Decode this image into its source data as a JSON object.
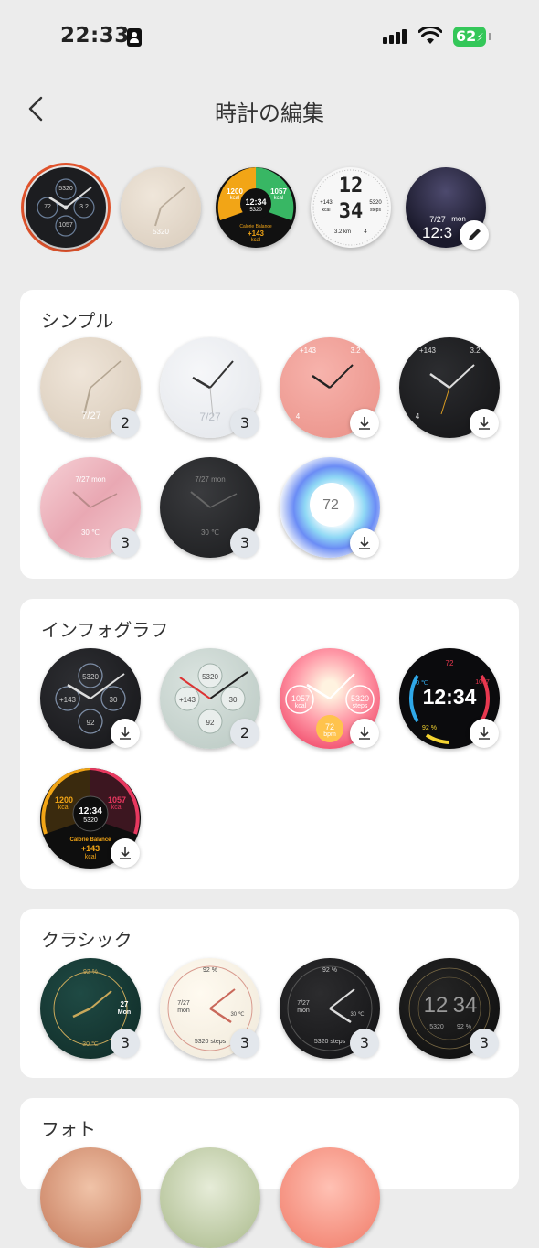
{
  "status_bar": {
    "time": "22:33",
    "battery": "62"
  },
  "nav": {
    "title": "時計の編集"
  },
  "current_faces": [
    {
      "name": "infograph-dark",
      "values": [
        "5320",
        "72",
        "3.2",
        "1057"
      ]
    },
    {
      "name": "simple-beige",
      "values": [
        "5320"
      ]
    },
    {
      "name": "calorie-balance",
      "values": [
        "1200",
        "kcal",
        "1057",
        "kcal",
        "12:34",
        "5320",
        "Calorie Balance",
        "+143",
        "kcal"
      ]
    },
    {
      "name": "digital-white",
      "values": [
        "12",
        "34",
        "+143",
        "kcal",
        "5320",
        "steps",
        "3.2 km",
        "4"
      ]
    },
    {
      "name": "photo-night",
      "values": [
        "7/27",
        "mon",
        "12:3"
      ]
    }
  ],
  "sections": [
    {
      "title": "シンプル",
      "faces": [
        {
          "style": "beige",
          "text": [
            "7/27"
          ],
          "badge": "2"
        },
        {
          "style": "white",
          "text": [
            "7/27"
          ],
          "badge": "3"
        },
        {
          "style": "pink",
          "text": [
            "+143",
            "3.2",
            "4"
          ],
          "download": true
        },
        {
          "style": "black",
          "text": [
            "+143",
            "3.2",
            "4"
          ],
          "download": true
        },
        {
          "style": "marble",
          "text": [
            "7/27 mon",
            "30 ℃"
          ],
          "badge": "3"
        },
        {
          "style": "leather",
          "text": [
            "7/27 mon",
            "30 ℃"
          ],
          "badge": "3"
        },
        {
          "style": "glow",
          "text": [
            "72"
          ],
          "download": true
        }
      ]
    },
    {
      "title": "インフォグラフ",
      "faces": [
        {
          "style": "info-dark",
          "text": [
            "5320",
            "+143",
            "30",
            "92"
          ],
          "download": true
        },
        {
          "style": "info-mint",
          "text": [
            "5320",
            "+143",
            "30",
            "92"
          ],
          "badge": "2"
        },
        {
          "style": "info-gradient",
          "text": [
            "1057",
            "kcal",
            "5320",
            "steps",
            "72",
            "bpm"
          ],
          "download": true
        },
        {
          "style": "info-digital",
          "text": [
            "12:34",
            "72",
            "30 ℃",
            "1057",
            "92 %"
          ],
          "download": true
        },
        {
          "style": "info-calorie",
          "text": [
            "1200",
            "kcal",
            "1057",
            "kcal",
            "12:34",
            "5320",
            "Calorie Balance",
            "+143",
            "kcal"
          ],
          "download": true
        }
      ]
    },
    {
      "title": "クラシック",
      "faces": [
        {
          "style": "classic-green",
          "text": [
            "92 %",
            "27",
            "Mon",
            "30 ℃"
          ],
          "badge": "3"
        },
        {
          "style": "classic-cream",
          "text": [
            "92 %",
            "7/27",
            "mon",
            "30 ℃",
            "5320 steps"
          ],
          "badge": "3"
        },
        {
          "style": "classic-black",
          "text": [
            "92 %",
            "7/27",
            "mon",
            "30 ℃",
            "5320 steps"
          ],
          "badge": "3"
        },
        {
          "style": "classic-digital",
          "text": [
            "12",
            "34",
            "5320",
            "92 %"
          ],
          "badge": "3"
        }
      ]
    },
    {
      "title": "フォト",
      "faces": []
    }
  ],
  "colors": {
    "selection": "#e0532c",
    "battery": "#34c759",
    "background": "#ececec"
  }
}
